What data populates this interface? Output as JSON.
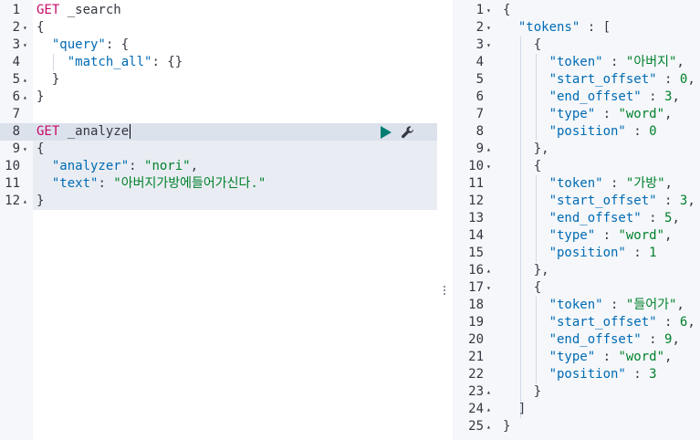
{
  "request_editor": {
    "lines": [
      {
        "num": "1",
        "fold": "",
        "parts": [
          [
            "method",
            "GET"
          ],
          [
            "path",
            " _search"
          ]
        ]
      },
      {
        "num": "2",
        "fold": "▾",
        "parts": [
          [
            "punct",
            "{"
          ]
        ]
      },
      {
        "num": "3",
        "fold": "▾",
        "parts": [
          [
            "punct",
            "  "
          ],
          [
            "key",
            "\"query\""
          ],
          [
            "punct",
            ": {"
          ]
        ]
      },
      {
        "num": "4",
        "fold": "",
        "parts": [
          [
            "punct",
            "    "
          ],
          [
            "key",
            "\"match_all\""
          ],
          [
            "punct",
            ": {}"
          ]
        ]
      },
      {
        "num": "5",
        "fold": "▴",
        "parts": [
          [
            "punct",
            "  }"
          ]
        ]
      },
      {
        "num": "6",
        "fold": "▴",
        "parts": [
          [
            "punct",
            "}"
          ]
        ]
      },
      {
        "num": "7",
        "fold": "",
        "parts": []
      },
      {
        "num": "8",
        "fold": "",
        "parts": [
          [
            "method",
            "GET"
          ],
          [
            "path",
            " _analyze"
          ]
        ]
      },
      {
        "num": "9",
        "fold": "▾",
        "parts": [
          [
            "punct",
            "{"
          ]
        ]
      },
      {
        "num": "10",
        "fold": "",
        "parts": [
          [
            "punct",
            "  "
          ],
          [
            "key",
            "\"analyzer\""
          ],
          [
            "punct",
            ": "
          ],
          [
            "str",
            "\"nori\""
          ],
          [
            "punct",
            ","
          ]
        ]
      },
      {
        "num": "11",
        "fold": "",
        "parts": [
          [
            "punct",
            "  "
          ],
          [
            "key",
            "\"text\""
          ],
          [
            "punct",
            ": "
          ],
          [
            "str",
            "\"아버지가방에들어가신다.\""
          ]
        ]
      },
      {
        "num": "12",
        "fold": "▴",
        "parts": [
          [
            "punct",
            "}"
          ]
        ]
      }
    ],
    "run_icon": "play-icon",
    "settings_icon": "wrench-icon"
  },
  "response_viewer": {
    "lines": [
      {
        "num": "1",
        "fold": "▾",
        "parts": [
          [
            "punct",
            "{"
          ]
        ]
      },
      {
        "num": "2",
        "fold": "▾",
        "parts": [
          [
            "punct",
            "  "
          ],
          [
            "key",
            "\"tokens\""
          ],
          [
            "punct",
            " : ["
          ]
        ]
      },
      {
        "num": "3",
        "fold": "▾",
        "parts": [
          [
            "punct",
            "    {"
          ]
        ]
      },
      {
        "num": "4",
        "fold": "",
        "parts": [
          [
            "punct",
            "      "
          ],
          [
            "key",
            "\"token\""
          ],
          [
            "punct",
            " : "
          ],
          [
            "str",
            "\"아버지\""
          ],
          [
            "punct",
            ","
          ]
        ]
      },
      {
        "num": "5",
        "fold": "",
        "parts": [
          [
            "punct",
            "      "
          ],
          [
            "key",
            "\"start_offset\""
          ],
          [
            "punct",
            " : "
          ],
          [
            "num",
            "0"
          ],
          [
            "punct",
            ","
          ]
        ]
      },
      {
        "num": "6",
        "fold": "",
        "parts": [
          [
            "punct",
            "      "
          ],
          [
            "key",
            "\"end_offset\""
          ],
          [
            "punct",
            " : "
          ],
          [
            "num",
            "3"
          ],
          [
            "punct",
            ","
          ]
        ]
      },
      {
        "num": "7",
        "fold": "",
        "parts": [
          [
            "punct",
            "      "
          ],
          [
            "key",
            "\"type\""
          ],
          [
            "punct",
            " : "
          ],
          [
            "str",
            "\"word\""
          ],
          [
            "punct",
            ","
          ]
        ]
      },
      {
        "num": "8",
        "fold": "",
        "parts": [
          [
            "punct",
            "      "
          ],
          [
            "key",
            "\"position\""
          ],
          [
            "punct",
            " : "
          ],
          [
            "num",
            "0"
          ]
        ]
      },
      {
        "num": "9",
        "fold": "▴",
        "parts": [
          [
            "punct",
            "    },"
          ]
        ]
      },
      {
        "num": "10",
        "fold": "▾",
        "parts": [
          [
            "punct",
            "    {"
          ]
        ]
      },
      {
        "num": "11",
        "fold": "",
        "parts": [
          [
            "punct",
            "      "
          ],
          [
            "key",
            "\"token\""
          ],
          [
            "punct",
            " : "
          ],
          [
            "str",
            "\"가방\""
          ],
          [
            "punct",
            ","
          ]
        ]
      },
      {
        "num": "12",
        "fold": "",
        "parts": [
          [
            "punct",
            "      "
          ],
          [
            "key",
            "\"start_offset\""
          ],
          [
            "punct",
            " : "
          ],
          [
            "num",
            "3"
          ],
          [
            "punct",
            ","
          ]
        ]
      },
      {
        "num": "13",
        "fold": "",
        "parts": [
          [
            "punct",
            "      "
          ],
          [
            "key",
            "\"end_offset\""
          ],
          [
            "punct",
            " : "
          ],
          [
            "num",
            "5"
          ],
          [
            "punct",
            ","
          ]
        ]
      },
      {
        "num": "14",
        "fold": "",
        "parts": [
          [
            "punct",
            "      "
          ],
          [
            "key",
            "\"type\""
          ],
          [
            "punct",
            " : "
          ],
          [
            "str",
            "\"word\""
          ],
          [
            "punct",
            ","
          ]
        ]
      },
      {
        "num": "15",
        "fold": "",
        "parts": [
          [
            "punct",
            "      "
          ],
          [
            "key",
            "\"position\""
          ],
          [
            "punct",
            " : "
          ],
          [
            "num",
            "1"
          ]
        ]
      },
      {
        "num": "16",
        "fold": "▴",
        "parts": [
          [
            "punct",
            "    },"
          ]
        ]
      },
      {
        "num": "17",
        "fold": "▾",
        "parts": [
          [
            "punct",
            "    {"
          ]
        ]
      },
      {
        "num": "18",
        "fold": "",
        "parts": [
          [
            "punct",
            "      "
          ],
          [
            "key",
            "\"token\""
          ],
          [
            "punct",
            " : "
          ],
          [
            "str",
            "\"들어가\""
          ],
          [
            "punct",
            ","
          ]
        ]
      },
      {
        "num": "19",
        "fold": "",
        "parts": [
          [
            "punct",
            "      "
          ],
          [
            "key",
            "\"start_offset\""
          ],
          [
            "punct",
            " : "
          ],
          [
            "num",
            "6"
          ],
          [
            "punct",
            ","
          ]
        ]
      },
      {
        "num": "20",
        "fold": "",
        "parts": [
          [
            "punct",
            "      "
          ],
          [
            "key",
            "\"end_offset\""
          ],
          [
            "punct",
            " : "
          ],
          [
            "num",
            "9"
          ],
          [
            "punct",
            ","
          ]
        ]
      },
      {
        "num": "21",
        "fold": "",
        "parts": [
          [
            "punct",
            "      "
          ],
          [
            "key",
            "\"type\""
          ],
          [
            "punct",
            " : "
          ],
          [
            "str",
            "\"word\""
          ],
          [
            "punct",
            ","
          ]
        ]
      },
      {
        "num": "22",
        "fold": "",
        "parts": [
          [
            "punct",
            "      "
          ],
          [
            "key",
            "\"position\""
          ],
          [
            "punct",
            " : "
          ],
          [
            "num",
            "3"
          ]
        ]
      },
      {
        "num": "23",
        "fold": "▴",
        "parts": [
          [
            "punct",
            "    }"
          ]
        ]
      },
      {
        "num": "24",
        "fold": "▴",
        "parts": [
          [
            "punct",
            "  ]"
          ]
        ]
      },
      {
        "num": "25",
        "fold": "▴",
        "parts": [
          [
            "punct",
            "}"
          ]
        ]
      }
    ]
  },
  "colors": {
    "method": "#c80a68",
    "key": "#006bb4",
    "string": "#00802b",
    "run_button": "#017d73"
  }
}
